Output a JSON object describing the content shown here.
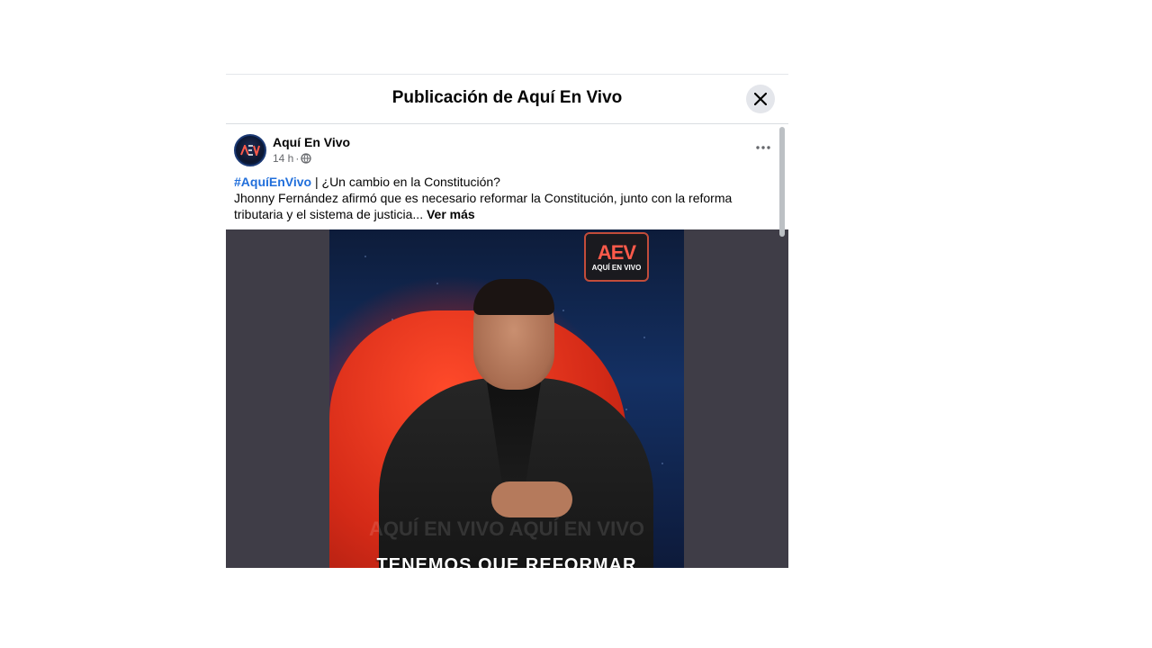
{
  "modal": {
    "title": "Publicación de Aquí En Vivo"
  },
  "post": {
    "page_name": "Aquí En Vivo",
    "time": "14 h",
    "meta_separator": "·",
    "privacy_icon": "globe-icon",
    "hashtag": "#AquíEnVivo",
    "separator": " | ",
    "headline": "¿Un cambio en la Constitución?",
    "body": "Jhonny Fernández afirmó que es necesario reformar la Constitución, junto con la reforma tributaria y el sistema de justicia...",
    "see_more": "Ver más"
  },
  "media": {
    "badge_logo": "AEV",
    "badge_text": "AQUÍ EN VIVO",
    "watermark": "AQUÍ EN VIVO   AQUÍ EN VIVO",
    "caption": "TENEMOS QUE REFORMAR"
  },
  "colors": {
    "hashtag": "#216fdb",
    "close_bg": "#e4e6eb",
    "media_bg": "#3f3d47"
  }
}
